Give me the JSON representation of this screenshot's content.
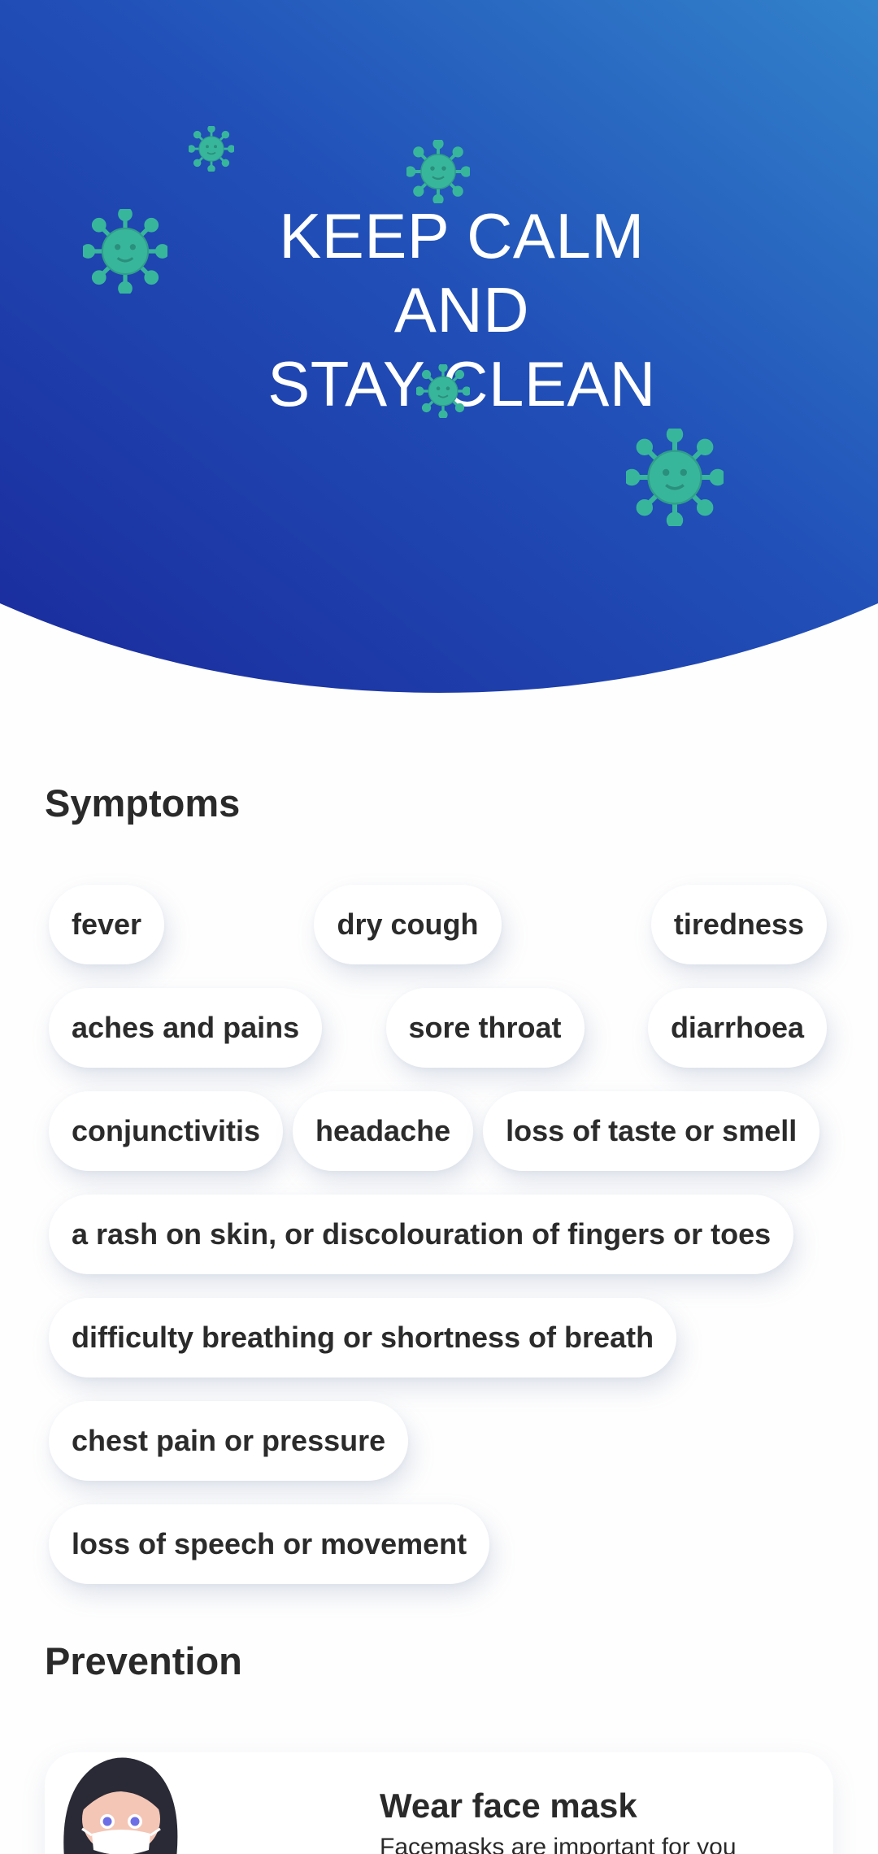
{
  "hero": {
    "title_lines": [
      "KEEP CALM",
      "AND",
      "STAY CLEAN"
    ],
    "gradient_colors": [
      "#1a2a9c",
      "#3280c8"
    ],
    "virus_color": "#38b69c"
  },
  "symptoms": {
    "title": "Symptoms",
    "items": [
      "fever",
      "dry cough",
      "tiredness",
      "aches and pains",
      "sore throat",
      "diarrhoea",
      "conjunctivitis",
      "headache",
      "loss of taste or smell",
      "a rash on skin, or discolouration of fingers or toes",
      "difficulty breathing or shortness of breath",
      "chest pain or pressure",
      "loss of speech or movement"
    ]
  },
  "prevention": {
    "title": "Prevention",
    "cards": [
      {
        "title": "Wear face mask",
        "text": "Facemasks are important for you",
        "icon": "woman-with-face-mask-icon"
      }
    ]
  }
}
